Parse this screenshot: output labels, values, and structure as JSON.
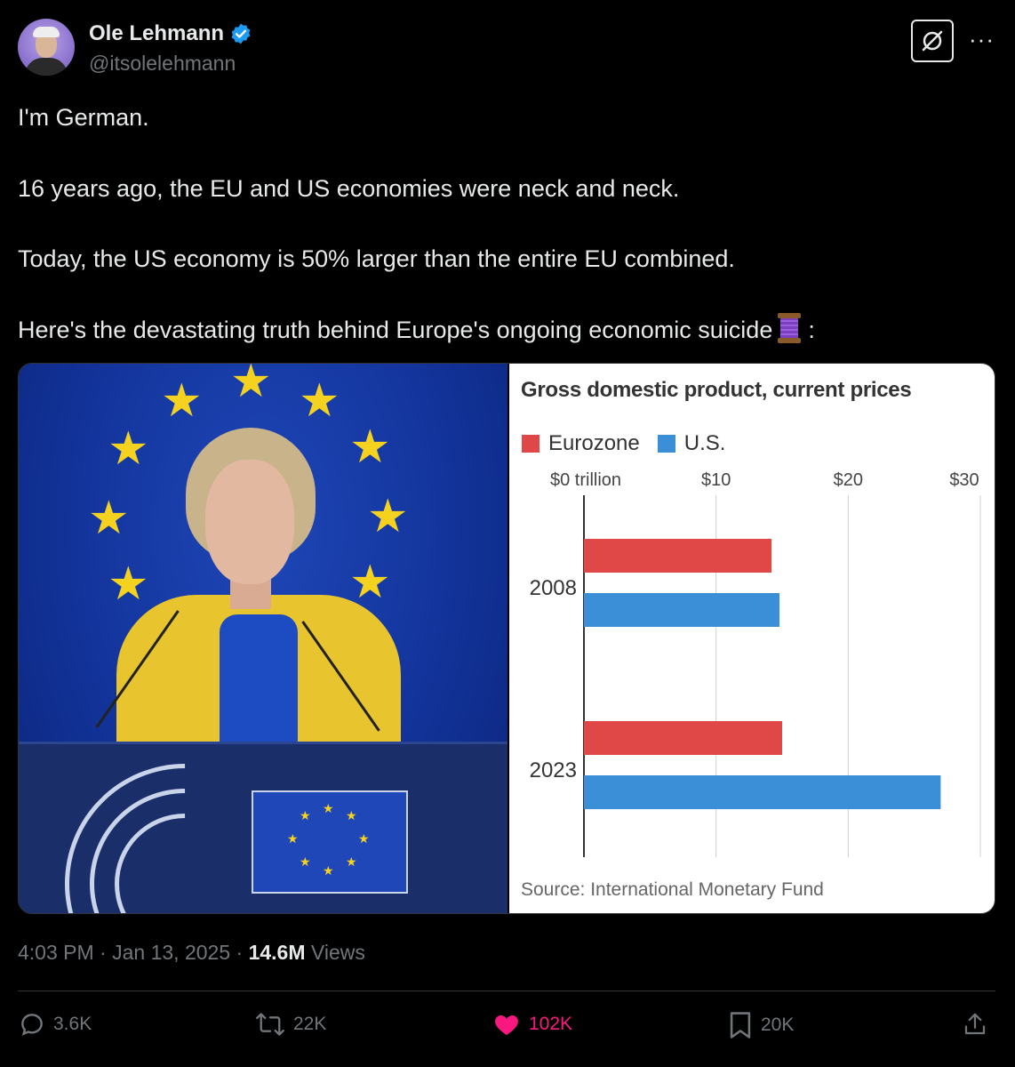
{
  "author": {
    "name": "Ole Lehmann",
    "handle": "@itsolelehmann",
    "verified": true
  },
  "tweet": {
    "line1": "I'm German.",
    "line2": "16 years ago, the EU and US economies were neck and neck.",
    "line3": "Today, the US economy is 50% larger than the entire EU combined.",
    "line4": "Here's the devastating truth behind Europe's ongoing economic suicide",
    "line4_end": ":",
    "emoji": "thread-spool-icon"
  },
  "chart_data": {
    "type": "bar",
    "title": "Gross domestic product, current prices",
    "categories": [
      "2008",
      "2023"
    ],
    "series": [
      {
        "name": "Eurozone",
        "color": "#e04848",
        "values": [
          14.2,
          15.0
        ]
      },
      {
        "name": "U.S.",
        "color": "#3b8fd6",
        "values": [
          14.8,
          27.0
        ]
      }
    ],
    "xticks": [
      "$0 trillion",
      "$10",
      "$20",
      "$30"
    ],
    "xtick_values": [
      0,
      10,
      20,
      30
    ],
    "xlim": [
      0,
      30
    ],
    "grid": true,
    "legend": "top-left",
    "source": "Source: International Monetary Fund"
  },
  "meta": {
    "time": "4:03 PM",
    "date": "Jan 13, 2025",
    "views_count": "14.6M",
    "views_label": "Views"
  },
  "actions": {
    "replies": "3.6K",
    "reposts": "22K",
    "likes": "102K",
    "bookmarks": "20K"
  },
  "colors": {
    "background": "#000000",
    "text": "#e7e9ea",
    "muted": "#71767b",
    "like": "#f91880",
    "verified": "#1d9bf0"
  }
}
